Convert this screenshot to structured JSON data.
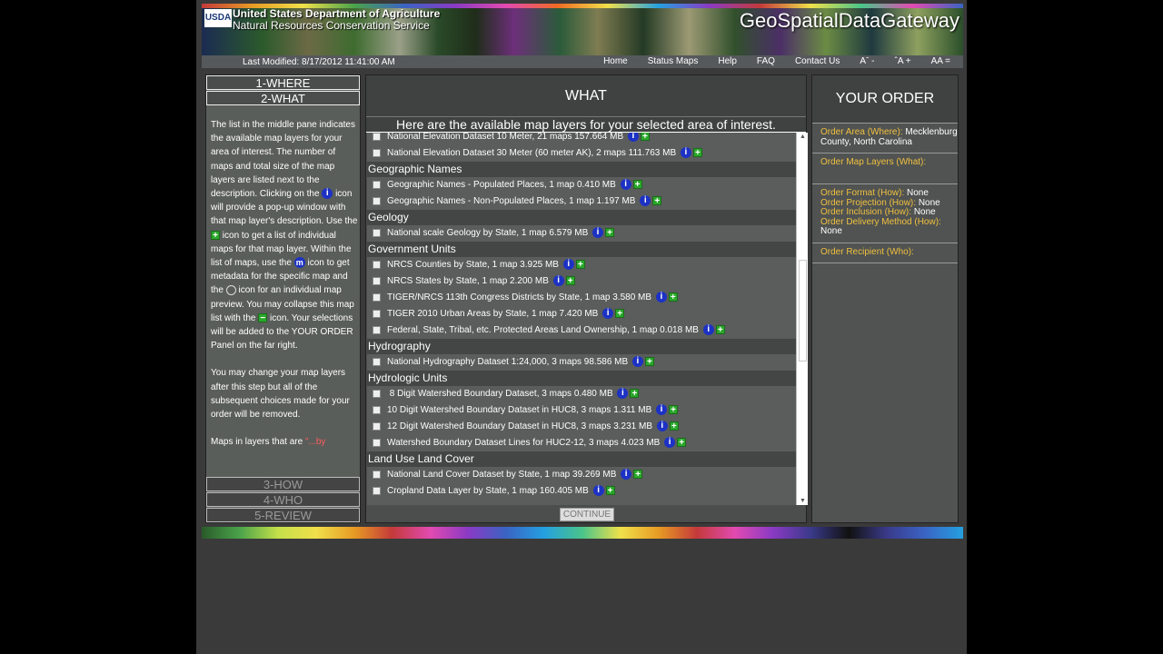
{
  "banner": {
    "agency_line1": "United States Department of Agriculture",
    "agency_line2": "Natural Resources Conservation Service",
    "usda_logo": "USDA",
    "brand": "GeoSpatialDataGateway"
  },
  "navbar": {
    "last_modified": "Last Modified: 8/17/2012 11:41:00 AM",
    "links": [
      "Home",
      "Status Maps",
      "Help",
      "FAQ",
      "Contact Us",
      "Aˉ -",
      "ˆA +",
      "AA ="
    ]
  },
  "left": {
    "steps_top": [
      "1-WHERE",
      "2-WHAT"
    ],
    "steps_bottom": [
      "3-HOW",
      "4-WHO",
      "5-REVIEW"
    ],
    "help": {
      "p1_a": "The list in the middle pane indicates the available map layers for your area of interest. The number of maps and total size of the map layers are listed next to the description. Clicking on the",
      "p1_b": "icon will provide a pop-up window with that map layer's description. Use the",
      "p1_c": "icon to get a list of individual maps for that map layer. Within the list of maps, use the",
      "p1_d": "icon to get metadata for the specific map and the",
      "p1_e": "icon for an individual map preview. You may collapse this map list with the",
      "p1_f": "icon. Your selections will be added to the YOUR ORDER Panel on the far right.",
      "p2": "You may change your map layers after this step but all of the subsequent choices made for your order will be removed.",
      "p3_a": "Maps in layers that are",
      "p3_b": "\"...by"
    },
    "icon_glyphs": {
      "info": "i",
      "plus": "+",
      "minus": "−",
      "metadata": "m"
    }
  },
  "middle": {
    "title": "WHAT",
    "subtitle": "Here are the available map layers for your selected area of interest.",
    "continue_label": "CONTINUE",
    "groups": [
      {
        "category": "",
        "items": [
          "National Elevation Dataset 10 Meter, 21 maps 157.664 MB",
          "National Elevation Dataset 30 Meter (60 meter AK), 2 maps 111.763 MB"
        ]
      },
      {
        "category": "Geographic Names",
        "items": [
          "Geographic Names - Populated Places, 1 map 0.410 MB",
          "Geographic Names - Non-Populated Places, 1 map 1.197 MB"
        ]
      },
      {
        "category": "Geology",
        "items": [
          "National scale Geology by State, 1 map 6.579 MB"
        ]
      },
      {
        "category": "Government Units",
        "items": [
          "NRCS Counties by State, 1 map 3.925 MB",
          "NRCS States by State, 1 map 2.200 MB",
          "TIGER/NRCS 113th Congress Districts by State, 1 map 3.580 MB",
          "TIGER 2010 Urban Areas by State, 1 map 7.420 MB",
          "Federal, State, Tribal, etc. Protected Areas Land Ownership, 1 map 0.018 MB"
        ]
      },
      {
        "category": "Hydrography",
        "items": [
          "National Hydrography Dataset 1:24,000, 3 maps 98.586 MB"
        ]
      },
      {
        "category": "Hydrologic Units",
        "items": [
          " 8 Digit Watershed Boundary Dataset, 3 maps 0.480 MB",
          "10 Digit Watershed Boundary Dataset in HUC8, 3 maps 1.311 MB",
          "12 Digit Watershed Boundary Dataset in HUC8, 3 maps 3.231 MB",
          "Watershed Boundary Dataset Lines for HUC2-12, 3 maps 4.023 MB"
        ]
      },
      {
        "category": "Land Use Land Cover",
        "items": [
          "National Land Cover Dataset by State, 1 map 39.269 MB",
          "Cropland Data Layer by State, 1 map 160.405 MB"
        ]
      }
    ]
  },
  "right": {
    "title": "YOUR ORDER",
    "area_label": "Order Area (Where):",
    "area_value": "Mecklenburg County, North Carolina",
    "layers_label": "Order Map Layers (What):",
    "format_label": "Order Format (How):",
    "format_value": "None",
    "projection_label": "Order Projection (How):",
    "projection_value": "None",
    "inclusion_label": "Order Inclusion (How):",
    "inclusion_value": "None",
    "delivery_label": "Order Delivery Method (How):",
    "delivery_value": "None",
    "recipient_label": "Order Recipient (Who):"
  }
}
